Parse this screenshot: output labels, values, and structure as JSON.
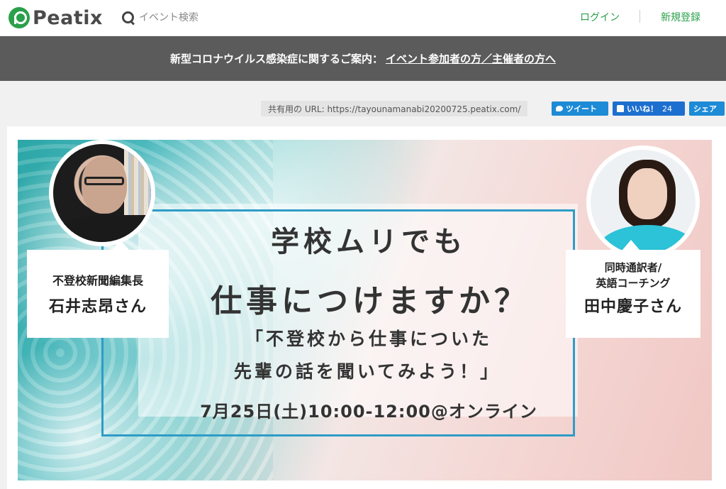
{
  "header": {
    "logo_text": "Peatix",
    "search_placeholder": "イベント検索",
    "login_label": "ログイン",
    "signup_label": "新規登録"
  },
  "notice": {
    "text": "新型コロナウイルス感染症に関するご案内：",
    "link_text": "イベント参加者の方／主催者の方へ"
  },
  "share": {
    "url_label": "共有用の URL: https://tayounamanabi20200725.peatix.com/",
    "tweet_label": "ツイート",
    "like_label": "いいね！",
    "like_count": "24",
    "share_label": "シェア"
  },
  "banner": {
    "left_role": "不登校新聞編集長",
    "left_name": "石井志昂さん",
    "right_role_1": "同時通訳者/",
    "right_role_2": "英語コーチング",
    "right_name": "田中慶子さん",
    "title_line1": "学校ムリでも",
    "title_line2": "仕事につけますか？",
    "subtitle_line1": "「不登校から仕事についた",
    "subtitle_line2": "先輩の話を聞いてみよう！」",
    "datetime": "7月25日(土)10:00-12:00@オンライン"
  },
  "colors": {
    "brand_green": "#2aa04a",
    "notice_bg": "#5b5b5b",
    "twitter_blue": "#1d8bd6",
    "facebook_blue": "#1d6fcf",
    "frame_blue": "#2e9cc7"
  }
}
